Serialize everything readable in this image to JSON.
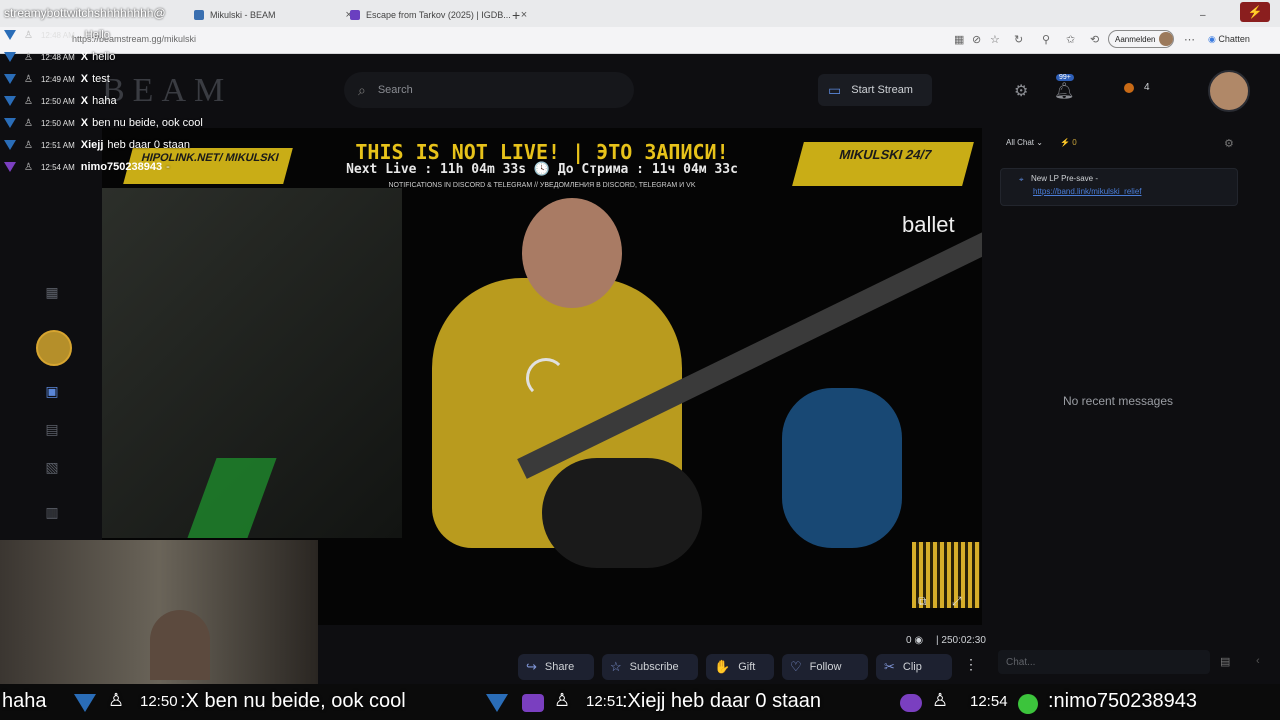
{
  "browser": {
    "tabs": [
      {
        "title": "Mikulski - BEAM",
        "close": "×"
      },
      {
        "title": "Escape from Tarkov (2025) | IGDB...",
        "close": "×"
      }
    ],
    "new_tab": "+",
    "url": "https://beamstream.gg/mikulski",
    "signin_label": "Aanmelden",
    "copilot_label": "Chatten"
  },
  "site": {
    "logo": "BEAM",
    "search_placeholder": "Search",
    "start_stream_label": "Start Stream",
    "notif_badge": "99+",
    "coin_count": "4"
  },
  "video": {
    "banner_title": "THIS IS NOT LIVE! | ЭТО ЗАПИСИ!",
    "banner_next": "Next Live : 11h 04m 33s  🕓  До Стрима : 11ч 04м 33с",
    "banner_notify": "NOTIFICATIONS IN DISCORD & TELEGRAM // УВЕДОМЛЕНИЯ В DISCORD, TELEGRAM И VK",
    "hipolink": "HIPOLINK.NET/ MIKULSKI",
    "mikulski_247": "MIKULSKI 24/7",
    "ballet": "ballet",
    "view_count": "0",
    "timer": "250:02:30"
  },
  "actions": {
    "share": "Share",
    "subscribe": "Subscribe",
    "gift": "Gift",
    "follow": "Follow",
    "clip": "Clip"
  },
  "chat": {
    "filter_label": "All Chat",
    "count": "0",
    "pinned_title": "New LP Pre-save -",
    "pinned_link": "https://band.link/mikulski_relief",
    "empty": "No recent messages",
    "input_placeholder": "Chat..."
  },
  "overlay": {
    "top_name": "streamybottwitchshhhhhhhh@",
    "messages": [
      {
        "ts": "12:48 AM",
        "name": "",
        "msg": "Hello"
      },
      {
        "ts": "12:48 AM",
        "name": "X",
        "msg": "hello"
      },
      {
        "ts": "12:49 AM",
        "name": "X",
        "msg": "test"
      },
      {
        "ts": "12:50 AM",
        "name": "X",
        "msg": "haha"
      },
      {
        "ts": "12:50 AM",
        "name": "X",
        "msg": "ben nu beide, ook cool"
      },
      {
        "ts": "12:51 AM",
        "name": "Xiejj",
        "msg": "heb daar 0 staan"
      },
      {
        "ts": "12:54 AM",
        "name": "nimo750238943",
        "msg": "-"
      }
    ]
  },
  "ticker": {
    "t1": "haha",
    "t2_time": "12:50",
    "t2": ":X ben nu beide, ook cool",
    "t3_time": "12:51",
    "t3": ":Xiejj heb daar 0 staan",
    "t4_time": "12:54",
    "t4": ":nimo750238943"
  },
  "colors": {
    "accent": "#2e5fb8",
    "brand_yellow": "#c9ad16",
    "link": "#4a7dd8"
  }
}
